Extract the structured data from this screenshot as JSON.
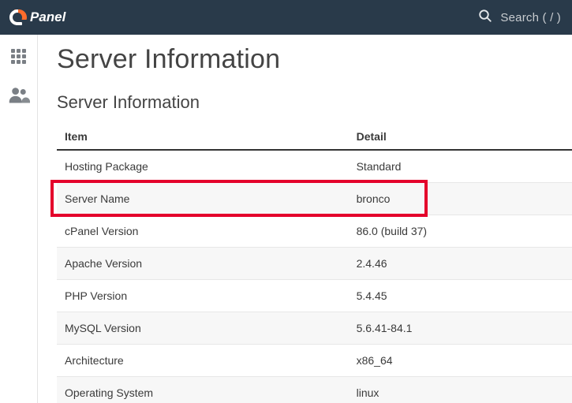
{
  "header": {
    "logo_text": "cPanel",
    "search_placeholder": "Search ( / )"
  },
  "sidebar": {
    "items": [
      {
        "name": "apps-icon"
      },
      {
        "name": "user-icon"
      }
    ]
  },
  "page": {
    "title": "Server Information",
    "section_title": "Server Information",
    "columns": {
      "item": "Item",
      "detail": "Detail"
    },
    "rows": [
      {
        "item": "Hosting Package",
        "detail": "Standard"
      },
      {
        "item": "Server Name",
        "detail": "bronco"
      },
      {
        "item": "cPanel Version",
        "detail": "86.0 (build 37)"
      },
      {
        "item": "Apache Version",
        "detail": "2.4.46"
      },
      {
        "item": "PHP Version",
        "detail": "5.4.45"
      },
      {
        "item": "MySQL Version",
        "detail": "5.6.41-84.1"
      },
      {
        "item": "Architecture",
        "detail": "x86_64"
      },
      {
        "item": "Operating System",
        "detail": "linux"
      }
    ],
    "highlight_row_index": 1
  }
}
